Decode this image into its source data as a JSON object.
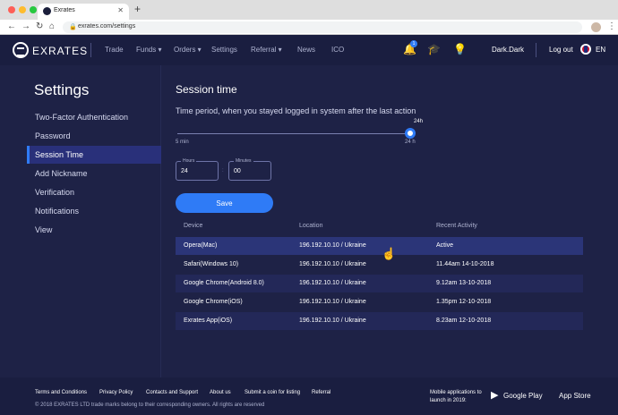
{
  "browser": {
    "tab_title": "Exrates",
    "url": "exrates.com/settings"
  },
  "nav": {
    "logo": "EXRATES",
    "items": [
      "Trade",
      "Funds ▾",
      "Orders ▾",
      "Settings",
      "Referral ▾",
      "News",
      "ICO"
    ],
    "notification_count": "1",
    "user": "Dark.Dark",
    "logout": "Log out",
    "language": "EN"
  },
  "sidebar": {
    "title": "Settings",
    "items": [
      {
        "label": "Two-Factor Authentication"
      },
      {
        "label": "Password"
      },
      {
        "label": "Session Time",
        "active": true
      },
      {
        "label": "Add Nickname"
      },
      {
        "label": "Verification"
      },
      {
        "label": "Notifications"
      },
      {
        "label": "View"
      }
    ]
  },
  "session": {
    "title": "Session time",
    "description": "Time period, when you stayed logged in system after the last action",
    "slider_min": "5 min",
    "slider_max": "24 h",
    "slider_value_label": "24h",
    "slider_fraction": 1.0,
    "hours_label": "Hours",
    "hours_value": "24",
    "minutes_label": "Minutes",
    "minutes_value": "00",
    "save": "Save"
  },
  "table": {
    "headers": [
      "Device",
      "Location",
      "Recent Activity"
    ],
    "rows": [
      {
        "device": "Opera(Mac)",
        "location": "196.192.10.10 / Ukraine",
        "activity": "Active"
      },
      {
        "device": "Safari(Windows 10)",
        "location": "196.192.10.10 / Ukraine",
        "activity": "11.44am 14-10-2018"
      },
      {
        "device": "Google Chrome(Android 8.0)",
        "location": "196.192.10.10 / Ukraine",
        "activity": "9.12am 13-10-2018"
      },
      {
        "device": "Google Chrome(iOS)",
        "location": "196.192.10.10 / Ukraine",
        "activity": "1.35pm 12-10-2018"
      },
      {
        "device": "Exrates App(iOS)",
        "location": "196.192.10.10 / Ukraine",
        "activity": "8.23am 12-10-2018"
      }
    ]
  },
  "footer": {
    "links": [
      "Terms and Conditions",
      "Privacy Policy",
      "Contacts and Support",
      "About us",
      "Submit a coin for listing",
      "Referral"
    ],
    "copyright": "© 2018 EXRATES LTD trade marks belong to their corresponding owners. All rights are reserved",
    "mobile_text": "Mobile applications to launch in 2019:",
    "google_play": "Google Play",
    "app_store": "App Store"
  },
  "colors": {
    "background": "#1e2246",
    "accent": "#2f7bf6",
    "active_row": "#2b3578"
  }
}
